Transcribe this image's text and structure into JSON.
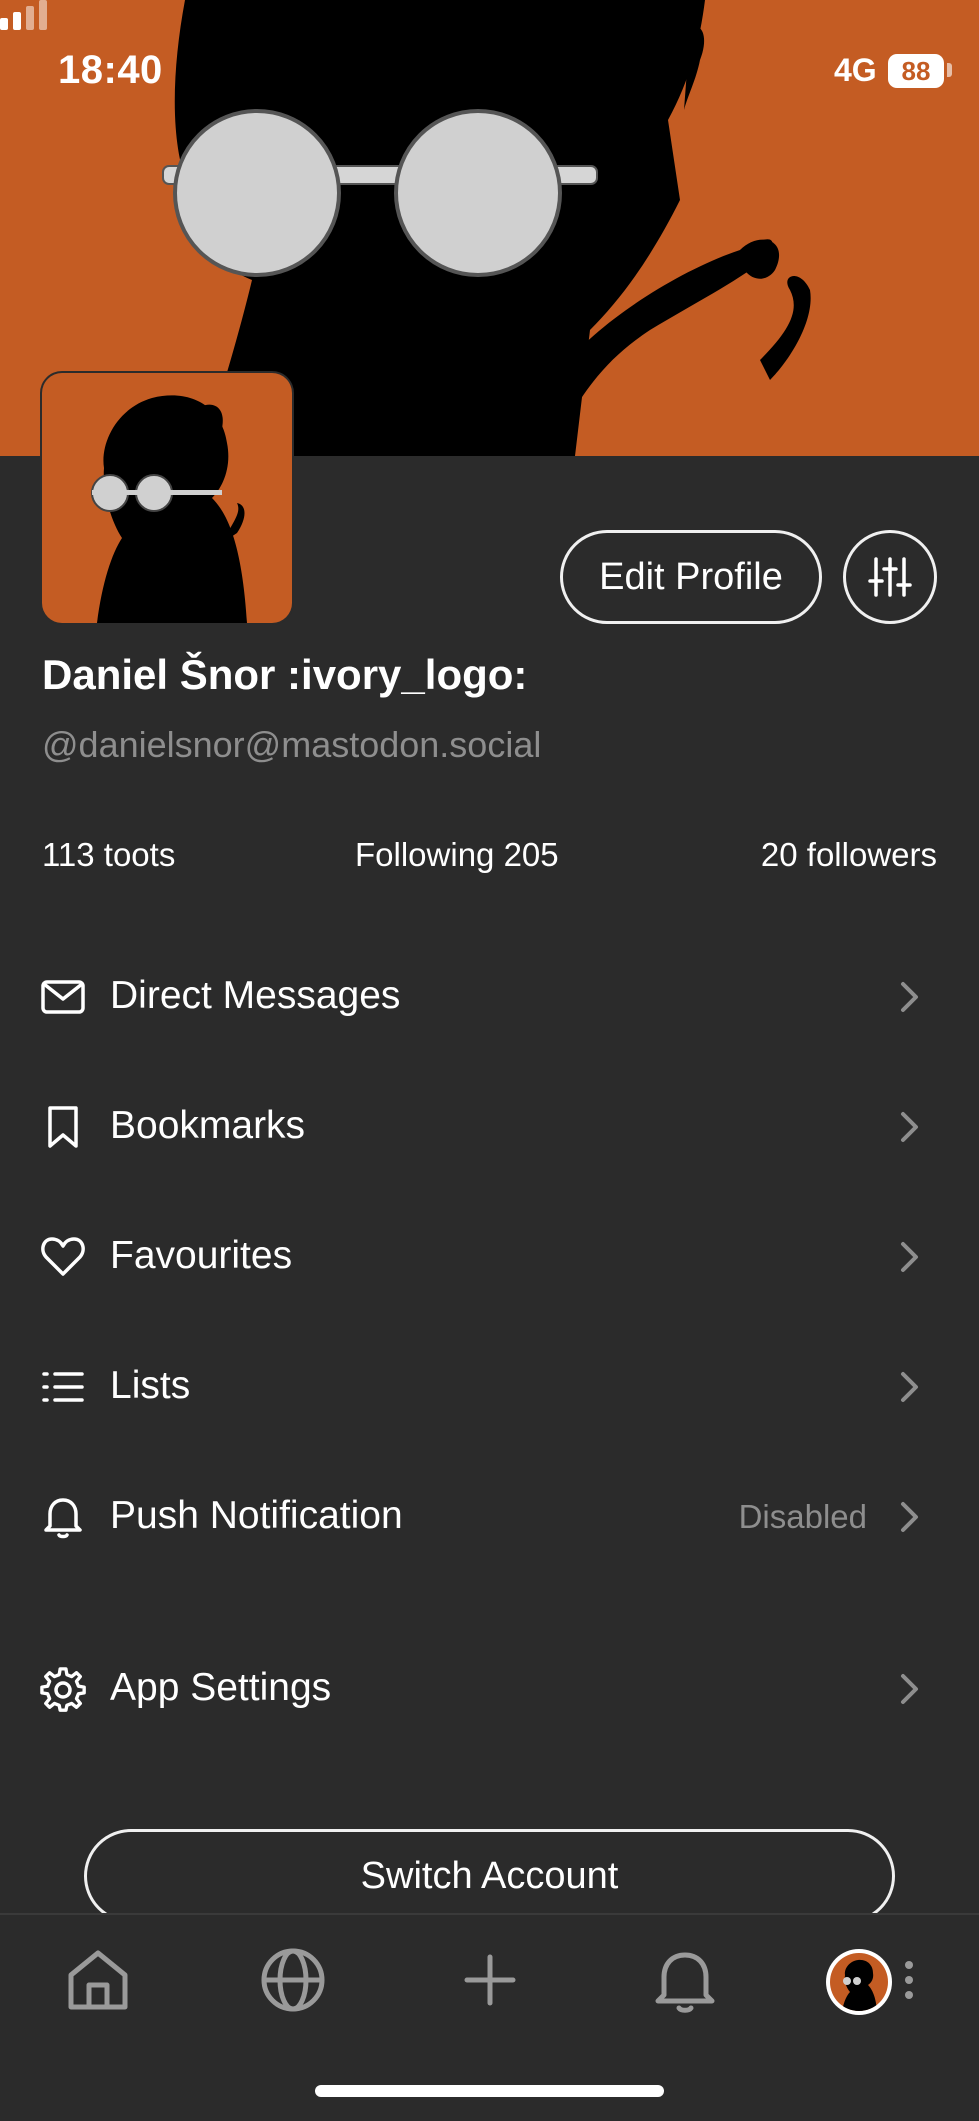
{
  "status_bar": {
    "time": "18:40",
    "network": "4G",
    "battery": "88"
  },
  "profile": {
    "edit_label": "Edit Profile",
    "display_name": "Daniel Šnor :ivory_logo:",
    "handle": "@danielsnor@mastodon.social"
  },
  "stats": {
    "toots": "113 toots",
    "following": "Following 205",
    "followers": "20 followers"
  },
  "menu": [
    {
      "label": "Direct Messages",
      "icon": "envelope-icon",
      "value": ""
    },
    {
      "label": "Bookmarks",
      "icon": "bookmark-icon",
      "value": ""
    },
    {
      "label": "Favourites",
      "icon": "heart-icon",
      "value": ""
    },
    {
      "label": "Lists",
      "icon": "list-icon",
      "value": ""
    },
    {
      "label": "Push Notification",
      "icon": "bell-icon",
      "value": "Disabled"
    },
    {
      "label": "App Settings",
      "icon": "gear-icon",
      "value": ""
    }
  ],
  "switch_account_label": "Switch Account",
  "tabs": [
    "home-icon",
    "globe-icon",
    "plus-icon",
    "bell-icon",
    "avatar"
  ],
  "colors": {
    "accent": "#c45c23",
    "background": "#2b2b2b",
    "muted": "#8e8e8e"
  }
}
